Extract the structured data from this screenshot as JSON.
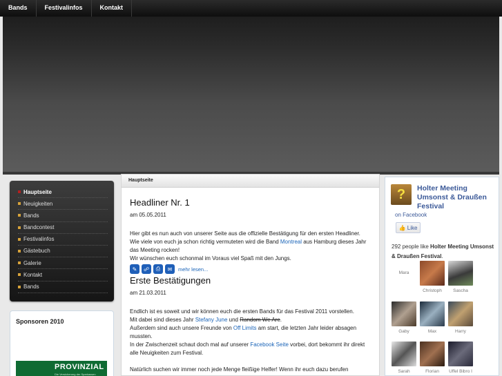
{
  "topnav": {
    "items": [
      "Bands",
      "Festivalinfos",
      "Kontakt"
    ]
  },
  "sidebar": {
    "menu": [
      "Hauptseite",
      "Neuigkeiten",
      "Bands",
      "Bandcontest",
      "Festivalinfos",
      "Gästebuch",
      "Galerie",
      "Kontakt",
      "Bands"
    ],
    "sponsor_title": "Sponsoren 2010",
    "sponsor_logo": {
      "brand": "PROVINZIAL",
      "tagline": "Die Versicherung der Sparkassen"
    }
  },
  "breadcrumb": "Hauptseite",
  "articles": [
    {
      "title": "Headliner Nr. 1",
      "date": "am 05.05.2011",
      "p1_a": "Hier gibt es nun auch von unserer Seite aus die offizielle Bestätigung für den ersten Headliner. Wie viele von euch ja schon richtig vermuteten wird die Band ",
      "p1_link": "Montreal",
      "p1_b": " aus Hamburg dieses Jahr das Meeting rocken!",
      "p2": "Wir wünschen euch schonmal im Voraus viel Spaß mit den Jungs.",
      "more": "mehr lesen..."
    },
    {
      "title": "Erste Bestätigungen",
      "date": "am 21.03.2011",
      "p1_a": "Endlich ist es soweit und wir können euch die ersten Bands für das Festival 2011 vorstellen.",
      "p2_a": "Mit dabei sind dieses Jahr ",
      "p2_link": "Stefany June",
      "p2_b": " und ",
      "p2_strike": "Random We Are",
      "p2_c": ".",
      "p3_a": "Außerdem sind auch unsere Freunde von ",
      "p3_link": "Off Limits",
      "p3_b": " am start, die letzten Jahr leider absagen mussten.",
      "p4_a": "In der Zwischenzeit schaut doch mal auf unserer ",
      "p4_link": "Facebook Seite",
      "p4_b": " vorbei, dort bekommt ihr direkt alle Neuigkeiten zum Festival.",
      "p5": "Natürlich suchen wir immer noch jede Menge fleißige Helfer! Wenn ihr euch dazu berufen"
    }
  ],
  "facebook": {
    "page_name": "Holter Meeting Umsonst & Draußen Festival",
    "on_facebook": "on Facebook",
    "like_label": "Like",
    "count_text": "292 people like ",
    "count_page": "Holter Meeting Umsonst & Draußen Festival",
    "fans": [
      "Mara",
      "Christoph",
      "Sascha",
      "Gaby",
      "Max",
      "Harry",
      "Sarah",
      "Florian",
      "Uffel Bibro I"
    ]
  },
  "colors": {
    "link": "#1a64b8",
    "fb_blue": "#3b5998",
    "bullet": "#d6a23a",
    "active_bullet": "#b32020",
    "sponsor_green": "#0f6b33"
  }
}
